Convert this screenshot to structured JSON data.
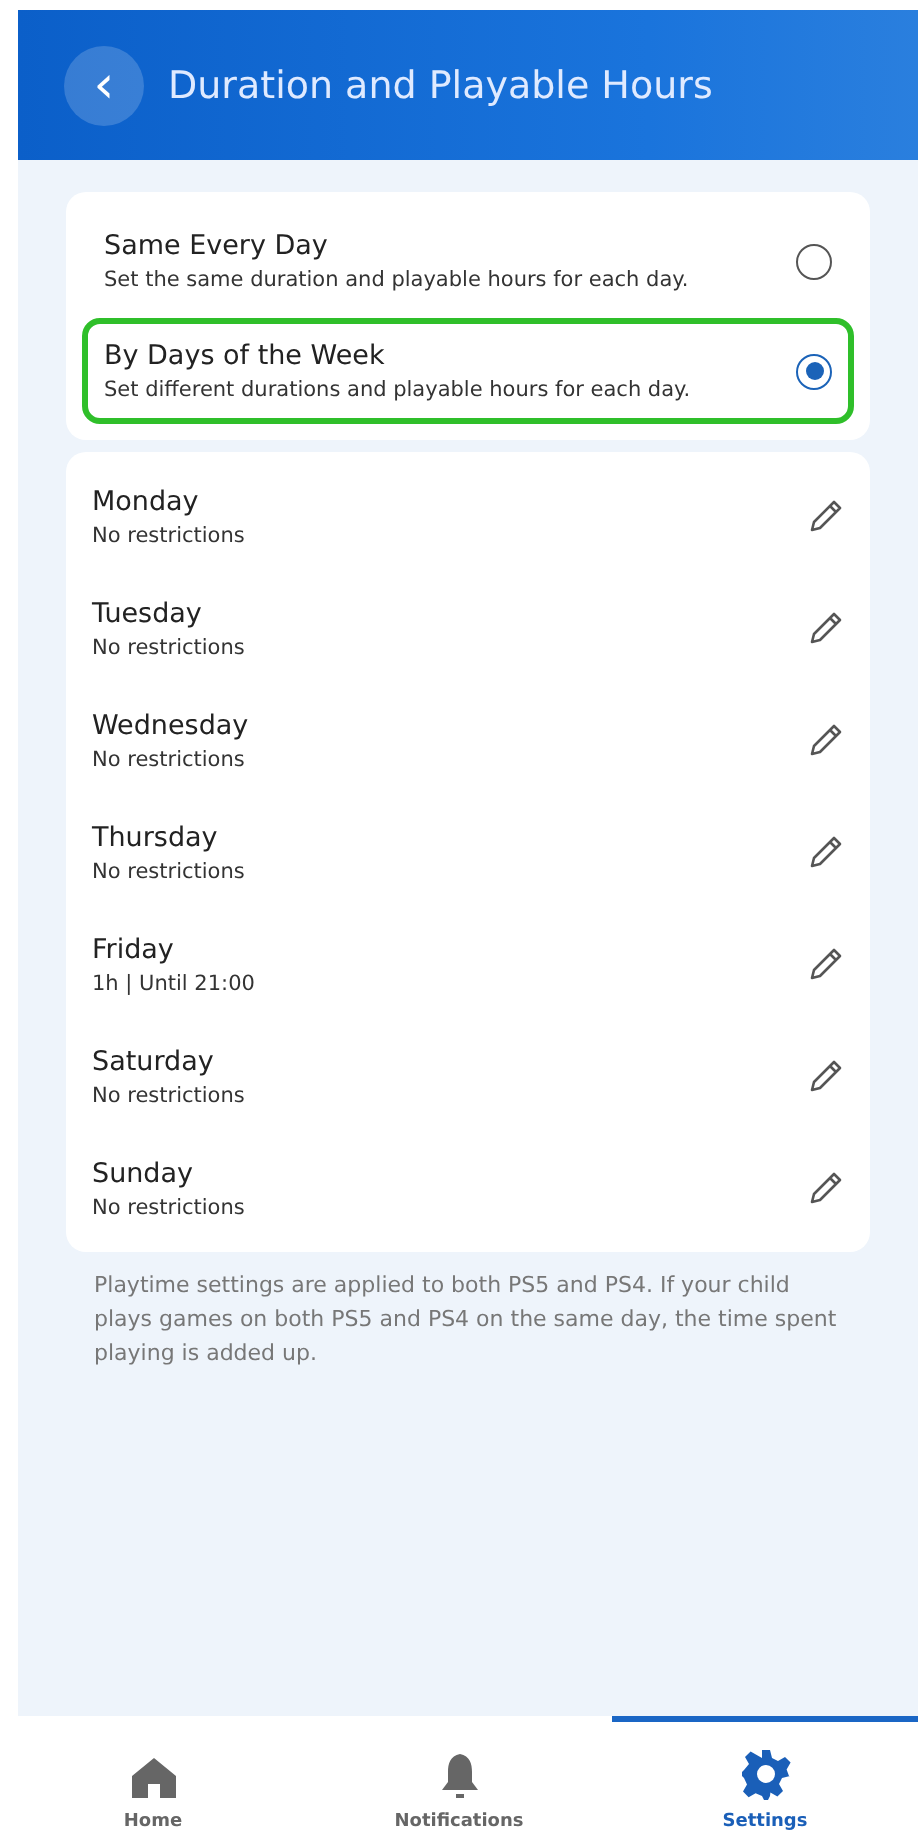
{
  "header": {
    "back_icon": "‹",
    "title": "Duration and Playable Hours"
  },
  "options": [
    {
      "title": "Same Every Day",
      "description": "Set the same duration and playable hours for each day.",
      "selected": false
    },
    {
      "title": "By Days of the Week",
      "description": "Set different durations and playable hours for each day.",
      "selected": true
    }
  ],
  "days": [
    {
      "name": "Monday",
      "setting": "No restrictions"
    },
    {
      "name": "Tuesday",
      "setting": "No restrictions"
    },
    {
      "name": "Wednesday",
      "setting": "No restrictions"
    },
    {
      "name": "Thursday",
      "setting": "No restrictions"
    },
    {
      "name": "Friday",
      "setting": "1h | Until 21:00"
    },
    {
      "name": "Saturday",
      "setting": "No restrictions"
    },
    {
      "name": "Sunday",
      "setting": "No restrictions"
    }
  ],
  "note": "Playtime settings are applied to both PS5 and PS4. If your child plays games on both PS5 and PS4 on the same day, the time spent playing is added up.",
  "nav": [
    {
      "kind": "home",
      "label": "Home",
      "selected": false
    },
    {
      "kind": "bell",
      "label": "Notifications",
      "selected": false
    },
    {
      "kind": "gear",
      "label": "Settings",
      "selected": true
    }
  ]
}
